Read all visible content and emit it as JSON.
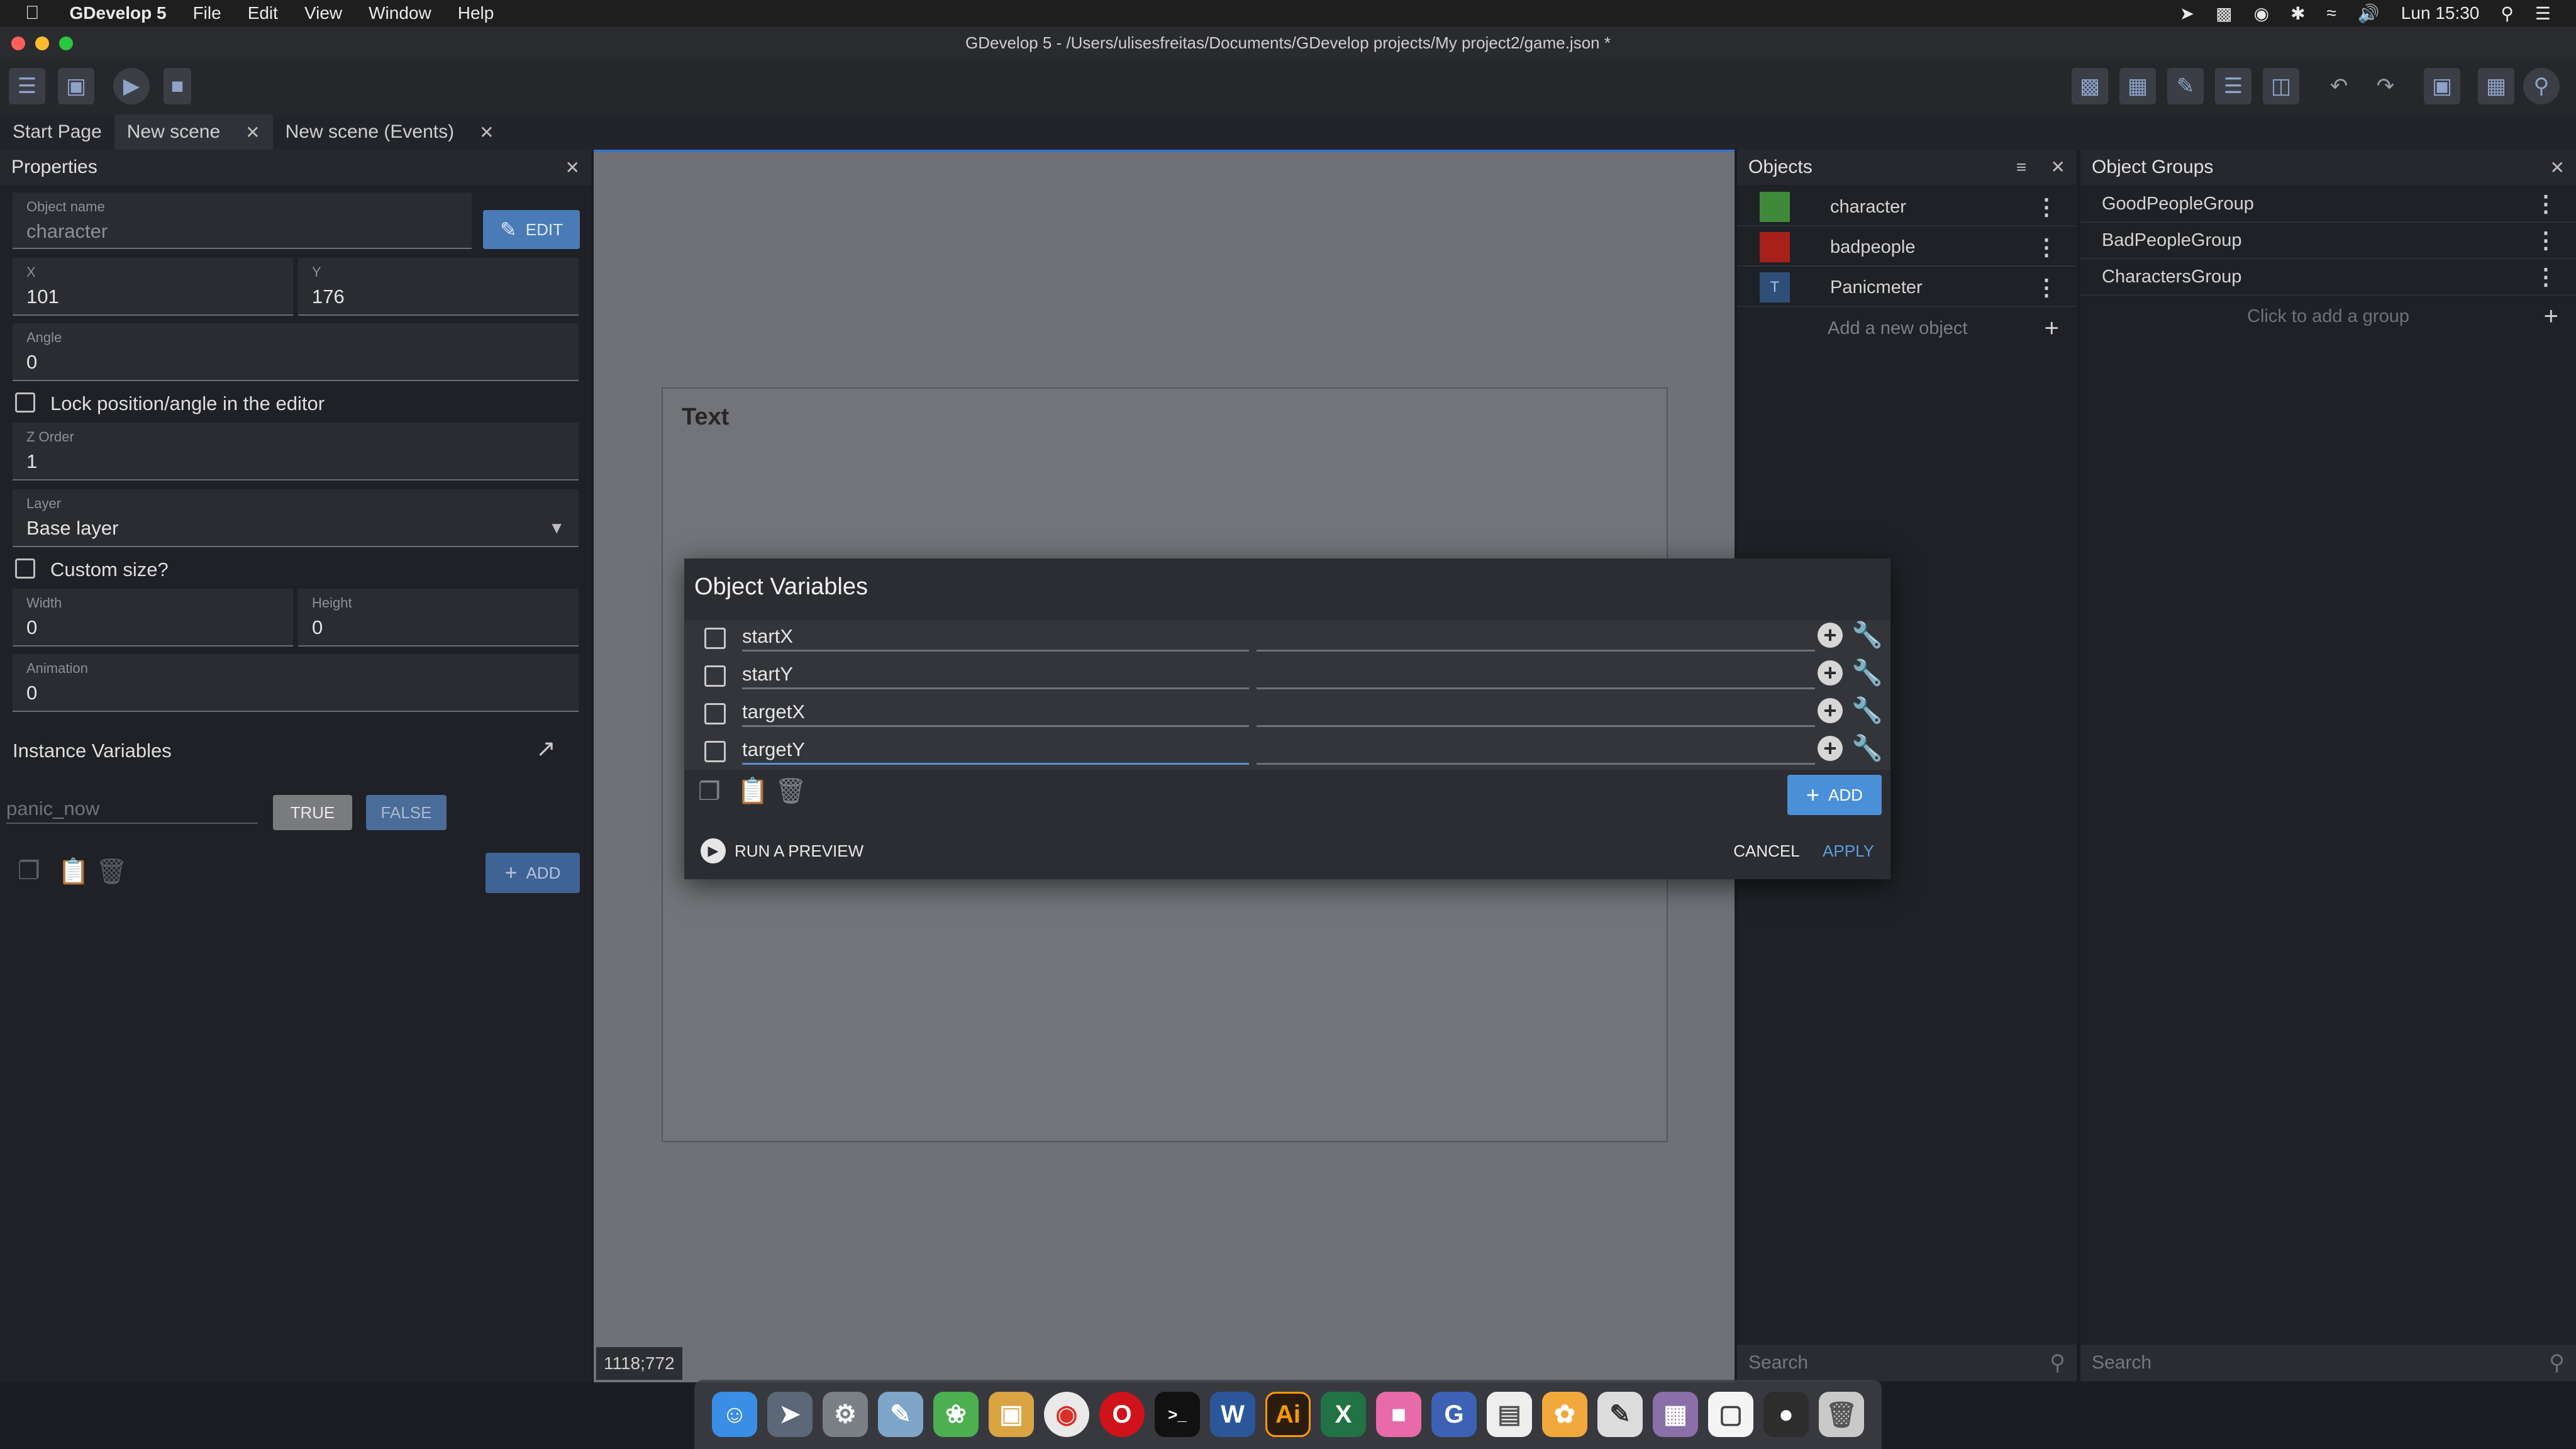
{
  "menubar": {
    "app_name": "GDevelop 5",
    "items": [
      "File",
      "Edit",
      "View",
      "Window",
      "Help"
    ],
    "clock": "Lun 15:30"
  },
  "window": {
    "title": "GDevelop 5 - /Users/ulisesfreitas/Documents/GDevelop projects/My project2/game.json *"
  },
  "tabs": [
    {
      "label": "Start Page"
    },
    {
      "label": "New scene"
    },
    {
      "label": "New scene (Events)"
    }
  ],
  "properties": {
    "title": "Properties",
    "object_name_label": "Object name",
    "object_name_value": "character",
    "edit_label": "EDIT",
    "x_label": "X",
    "x_value": "101",
    "y_label": "Y",
    "y_value": "176",
    "angle_label": "Angle",
    "angle_value": "0",
    "lock_label": "Lock position/angle in the editor",
    "zorder_label": "Z Order",
    "zorder_value": "1",
    "layer_label": "Layer",
    "layer_value": "Base layer",
    "custom_size_label": "Custom size?",
    "width_label": "Width",
    "width_value": "0",
    "height_label": "Height",
    "height_value": "0",
    "animation_label": "Animation",
    "animation_value": "0",
    "instance_vars_label": "Instance Variables",
    "var_name_placeholder": "panic_now",
    "true_label": "TRUE",
    "false_label": "FALSE",
    "add_label": "ADD"
  },
  "scene": {
    "text_object_label": "Text",
    "coords": "1118;772"
  },
  "objects": {
    "title": "Objects",
    "items": [
      {
        "name": "character",
        "color": "#3f8a3a"
      },
      {
        "name": "badpeople",
        "color": "#a8201a"
      },
      {
        "name": "Panicmeter",
        "color": "#2f4f78"
      }
    ],
    "add_label": "Add a new object",
    "search_placeholder": "Search"
  },
  "groups": {
    "title": "Object Groups",
    "items": [
      {
        "name": "GoodPeopleGroup"
      },
      {
        "name": "BadPeopleGroup"
      },
      {
        "name": "CharactersGroup"
      }
    ],
    "add_label": "Click to add a group",
    "search_placeholder": "Search"
  },
  "dialog": {
    "title": "Object Variables",
    "variables": [
      {
        "name": "startX"
      },
      {
        "name": "startY"
      },
      {
        "name": "targetX"
      },
      {
        "name": "targetY"
      }
    ],
    "add_label": "ADD",
    "run_preview_label": "RUN A PREVIEW",
    "cancel_label": "CANCEL",
    "apply_label": "APPLY"
  },
  "colors": {
    "accent": "#4a90d9",
    "panel_bg": "#1f2126",
    "scene_bg": "#6f7177"
  }
}
